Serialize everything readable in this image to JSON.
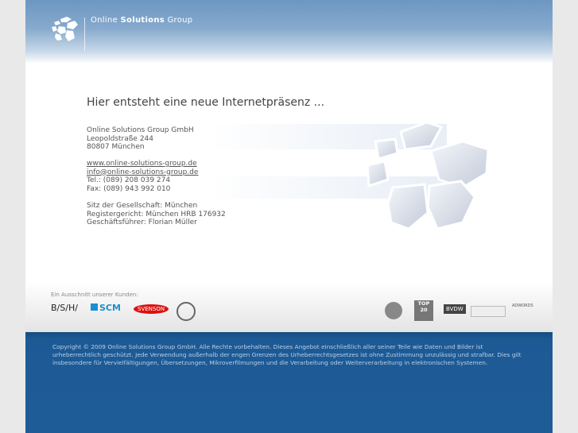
{
  "header": {
    "brand_prefix": "Online ",
    "brand_bold": "Solutions",
    "brand_suffix": " Group"
  },
  "main": {
    "headline": "Hier entsteht eine neue Internetpräsenz ...",
    "address": [
      "Online Solutions Group GmbH",
      "Leopoldstraße 244",
      "80807 München"
    ],
    "website": "www.online-solutions-group.de",
    "email": "info@online-solutions-group.de",
    "phone": "Tel.: (089) 208 039 274",
    "fax": "Fax: (089) 943 992 010",
    "legal": [
      "Sitz der Gesellschaft: München",
      "Registergericht: München HRB 176932",
      "Geschäftsführer: Florian Müller"
    ]
  },
  "clients": {
    "label": "Ein Ausschnitt unserer Kunden:",
    "logos": [
      "B/S/H/",
      "SCM",
      "SVENSON",
      "TOP 20",
      "BVDW",
      "ADWORDS"
    ]
  },
  "footer": {
    "copyright": "Copyright © 2009 Online Solutions Group GmbH. Alle Rechte vorbehalten. Dieses Angebot einschließlich aller seiner Teile wie Daten und Bilder ist urheberrechtlich geschützt. Jede Verwendung außerhalb der engen Grenzen des Urheberrechtsgesetzes ist ohne Zustimmung unzulässig und strafbar. Dies gilt insbesondere für Vervielfältigungen, Übersetzungen, Mikroverfilmungen und die Verarbeitung oder Weiterverarbeitung in elektronischen Systemen."
  }
}
